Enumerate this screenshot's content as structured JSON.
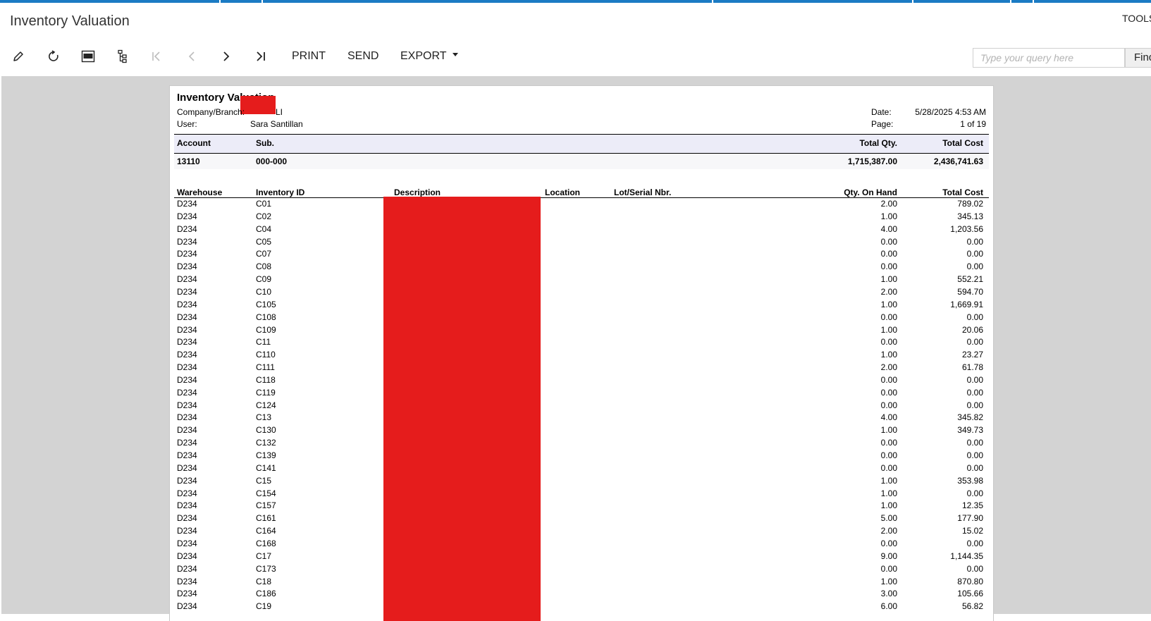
{
  "app": {
    "title": "Inventory Valuation",
    "tools_label": "TOOLS"
  },
  "toolbar": {
    "icons": [
      "edit-icon",
      "refresh-icon",
      "pdf-icon",
      "tree-icon",
      "first-page-icon",
      "previous-page-icon",
      "next-page-icon",
      "last-page-icon"
    ],
    "print_label": "PRINT",
    "send_label": "SEND",
    "export_label": "EXPORT",
    "search_placeholder": "Type your query here",
    "find_label": "Find"
  },
  "colors": {
    "accent": "#1b7bc4",
    "redaction": "#e51c1c",
    "band": "#ececf8",
    "viewer_bg": "#d3d3d3"
  },
  "report": {
    "title": "Inventory Valuation",
    "company_label": "Company/Branch:",
    "company_value_suffix": "LI",
    "user_label": "User:",
    "user_value": "Sara Santillan",
    "date_label": "Date:",
    "date_value": "5/28/2025 4:53 AM",
    "page_label": "Page:",
    "page_value": "1 of 19",
    "summary_headers": {
      "account": "Account",
      "sub": "Sub.",
      "total_qty": "Total Qty.",
      "total_cost": "Total Cost"
    },
    "summary_row": {
      "account": "13110",
      "sub": "000-000",
      "total_qty": "1,715,387.00",
      "total_cost": "2,436,741.63"
    },
    "detail_headers": {
      "warehouse": "Warehouse",
      "inventory_id": "Inventory ID",
      "description": "Description",
      "location": "Location",
      "lot_serial": "Lot/Serial Nbr.",
      "qty_on_hand": "Qty. On Hand",
      "total_cost": "Total Cost"
    },
    "rows": [
      {
        "warehouse": "D234",
        "inventory_id": "C01",
        "qty": "2.00",
        "cost": "789.02"
      },
      {
        "warehouse": "D234",
        "inventory_id": "C02",
        "qty": "1.00",
        "cost": "345.13"
      },
      {
        "warehouse": "D234",
        "inventory_id": "C04",
        "qty": "4.00",
        "cost": "1,203.56"
      },
      {
        "warehouse": "D234",
        "inventory_id": "C05",
        "qty": "0.00",
        "cost": "0.00"
      },
      {
        "warehouse": "D234",
        "inventory_id": "C07",
        "qty": "0.00",
        "cost": "0.00"
      },
      {
        "warehouse": "D234",
        "inventory_id": "C08",
        "qty": "0.00",
        "cost": "0.00"
      },
      {
        "warehouse": "D234",
        "inventory_id": "C09",
        "qty": "1.00",
        "cost": "552.21"
      },
      {
        "warehouse": "D234",
        "inventory_id": "C10",
        "qty": "2.00",
        "cost": "594.70"
      },
      {
        "warehouse": "D234",
        "inventory_id": "C105",
        "qty": "1.00",
        "cost": "1,669.91"
      },
      {
        "warehouse": "D234",
        "inventory_id": "C108",
        "qty": "0.00",
        "cost": "0.00"
      },
      {
        "warehouse": "D234",
        "inventory_id": "C109",
        "qty": "1.00",
        "cost": "20.06"
      },
      {
        "warehouse": "D234",
        "inventory_id": "C11",
        "qty": "0.00",
        "cost": "0.00"
      },
      {
        "warehouse": "D234",
        "inventory_id": "C110",
        "qty": "1.00",
        "cost": "23.27"
      },
      {
        "warehouse": "D234",
        "inventory_id": "C111",
        "qty": "2.00",
        "cost": "61.78"
      },
      {
        "warehouse": "D234",
        "inventory_id": "C118",
        "qty": "0.00",
        "cost": "0.00"
      },
      {
        "warehouse": "D234",
        "inventory_id": "C119",
        "qty": "0.00",
        "cost": "0.00"
      },
      {
        "warehouse": "D234",
        "inventory_id": "C124",
        "qty": "0.00",
        "cost": "0.00"
      },
      {
        "warehouse": "D234",
        "inventory_id": "C13",
        "qty": "4.00",
        "cost": "345.82"
      },
      {
        "warehouse": "D234",
        "inventory_id": "C130",
        "qty": "1.00",
        "cost": "349.73"
      },
      {
        "warehouse": "D234",
        "inventory_id": "C132",
        "qty": "0.00",
        "cost": "0.00"
      },
      {
        "warehouse": "D234",
        "inventory_id": "C139",
        "qty": "0.00",
        "cost": "0.00"
      },
      {
        "warehouse": "D234",
        "inventory_id": "C141",
        "qty": "0.00",
        "cost": "0.00"
      },
      {
        "warehouse": "D234",
        "inventory_id": "C15",
        "qty": "1.00",
        "cost": "353.98"
      },
      {
        "warehouse": "D234",
        "inventory_id": "C154",
        "qty": "1.00",
        "cost": "0.00"
      },
      {
        "warehouse": "D234",
        "inventory_id": "C157",
        "qty": "1.00",
        "cost": "12.35"
      },
      {
        "warehouse": "D234",
        "inventory_id": "C161",
        "qty": "5.00",
        "cost": "177.90"
      },
      {
        "warehouse": "D234",
        "inventory_id": "C164",
        "qty": "2.00",
        "cost": "15.02"
      },
      {
        "warehouse": "D234",
        "inventory_id": "C168",
        "qty": "0.00",
        "cost": "0.00"
      },
      {
        "warehouse": "D234",
        "inventory_id": "C17",
        "qty": "9.00",
        "cost": "1,144.35"
      },
      {
        "warehouse": "D234",
        "inventory_id": "C173",
        "qty": "0.00",
        "cost": "0.00"
      },
      {
        "warehouse": "D234",
        "inventory_id": "C18",
        "qty": "1.00",
        "cost": "870.80"
      },
      {
        "warehouse": "D234",
        "inventory_id": "C186",
        "qty": "3.00",
        "cost": "105.66"
      },
      {
        "warehouse": "D234",
        "inventory_id": "C19",
        "qty": "6.00",
        "cost": "56.82"
      }
    ]
  }
}
